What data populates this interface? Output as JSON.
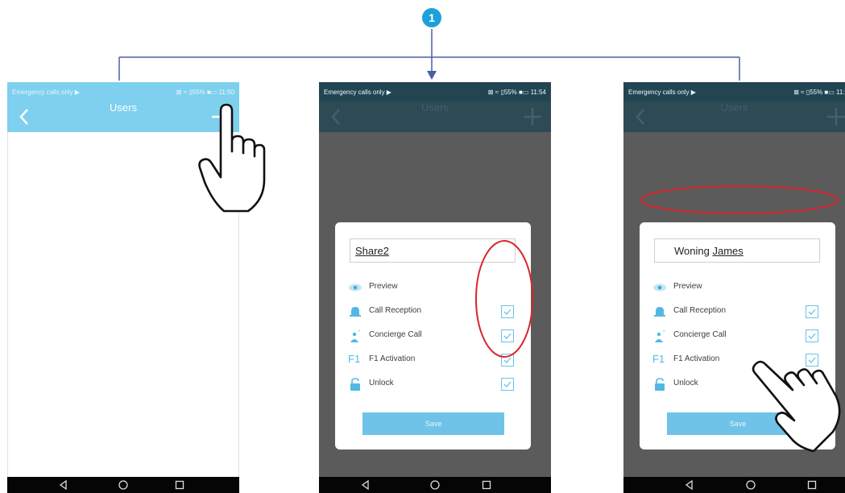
{
  "step": {
    "number": "1",
    "badge_color": "#1ea0dc",
    "line_color": "#4a5fa5"
  },
  "colors": {
    "header_light": "#7ed0ee",
    "header_dim": "#2d4a55",
    "overlay": "#5b5b5b",
    "save_button": "#6fc3e8",
    "annotation_red": "#d7262c",
    "checkbox_border": "#6bc3e5"
  },
  "status_bar": {
    "left": "Emergency calls only ▶",
    "right_1": "⊠ ≈ ▯55% ■▭ 11:50",
    "right_2": "⊠ ≈ ▯55% ■▭ 11:54",
    "right_3": "⊠ ≈ ▯55% ■▭ 11:5"
  },
  "header": {
    "title": "Users",
    "back_icon": "chevron-left-icon",
    "add_icon": "plus-icon"
  },
  "dialog_1": {
    "name_value": "Share2",
    "permissions": [
      {
        "label": "Preview",
        "icon": "eye-icon",
        "has_checkbox": false
      },
      {
        "label": "Call Reception",
        "icon": "bell-icon",
        "checked": true
      },
      {
        "label": "Concierge Call",
        "icon": "concierge-icon",
        "checked": true
      },
      {
        "label": "F1 Activation",
        "icon": "f1-icon",
        "checked": true
      },
      {
        "label": "Unlock",
        "icon": "padlock-icon",
        "checked": true
      }
    ],
    "save_label": "Save"
  },
  "dialog_2": {
    "name_value_prefix": "Woning ",
    "name_value_underlined": "James",
    "permissions": [
      {
        "label": "Preview",
        "icon": "eye-icon",
        "has_checkbox": false
      },
      {
        "label": "Call Reception",
        "icon": "bell-icon",
        "checked": true
      },
      {
        "label": "Concierge Call",
        "icon": "concierge-icon",
        "checked": true
      },
      {
        "label": "F1 Activation",
        "icon": "f1-icon",
        "checked": true
      },
      {
        "label": "Unlock",
        "icon": "padlock-icon",
        "checked": true
      }
    ],
    "save_label": "Save"
  },
  "f1_glyph": "F1",
  "nav": {
    "back_icon": "triangle-back-icon",
    "home_icon": "circle-home-icon",
    "recents_icon": "square-recents-icon"
  },
  "annotations": {
    "hand_icon": "pointing-hand-icon"
  }
}
